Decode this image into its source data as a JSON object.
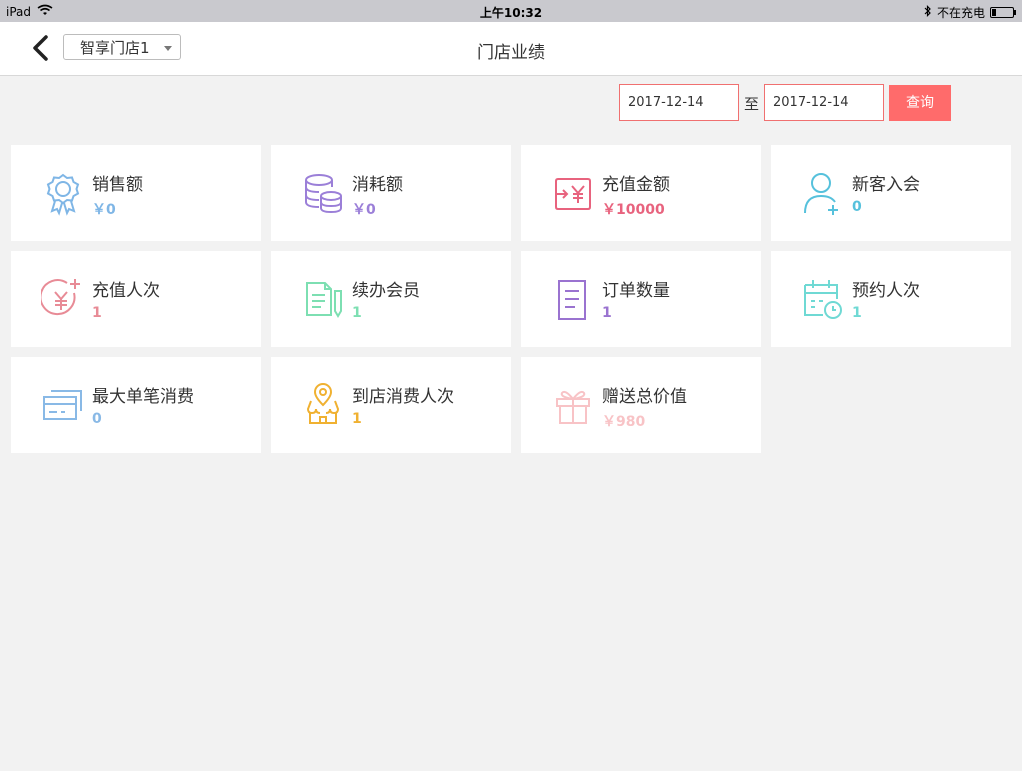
{
  "status_bar": {
    "device": "iPad",
    "time": "上午10:32",
    "charging_text": "不在充电"
  },
  "nav": {
    "title": "门店业绩",
    "store_selected": "智享门店1"
  },
  "filter": {
    "date_from": "2017-12-14",
    "separator": "至",
    "date_to": "2017-12-14",
    "query_label": "查询"
  },
  "stats": [
    {
      "label": "销售额",
      "value": "￥0",
      "icon": "award-icon",
      "color": "#7fb6e6"
    },
    {
      "label": "消耗额",
      "value": "￥0",
      "icon": "coins-icon",
      "color": "#9b7fd8"
    },
    {
      "label": "充值金额",
      "value": "￥10000",
      "icon": "yen-transfer-icon",
      "color": "#e8637e"
    },
    {
      "label": "新客入会",
      "value": "0",
      "icon": "add-user-icon",
      "color": "#56c1dc"
    },
    {
      "label": "充值人次",
      "value": "1",
      "icon": "yen-plus-icon",
      "color": "#e88b96"
    },
    {
      "label": "续办会员",
      "value": "1",
      "icon": "document-edit-icon",
      "color": "#7ddfb2"
    },
    {
      "label": "订单数量",
      "value": "1",
      "icon": "list-document-icon",
      "color": "#9a73d0"
    },
    {
      "label": "预约人次",
      "value": "1",
      "icon": "calendar-clock-icon",
      "color": "#6fd9d4"
    },
    {
      "label": "最大单笔消费",
      "value": "0",
      "icon": "credit-cards-icon",
      "color": "#89b9e6"
    },
    {
      "label": "到店消费人次",
      "value": "1",
      "icon": "store-location-icon",
      "color": "#f0b131"
    },
    {
      "label": "赠送总价值",
      "value": "￥980",
      "icon": "gift-icon",
      "color": "#f8c3c6"
    }
  ]
}
